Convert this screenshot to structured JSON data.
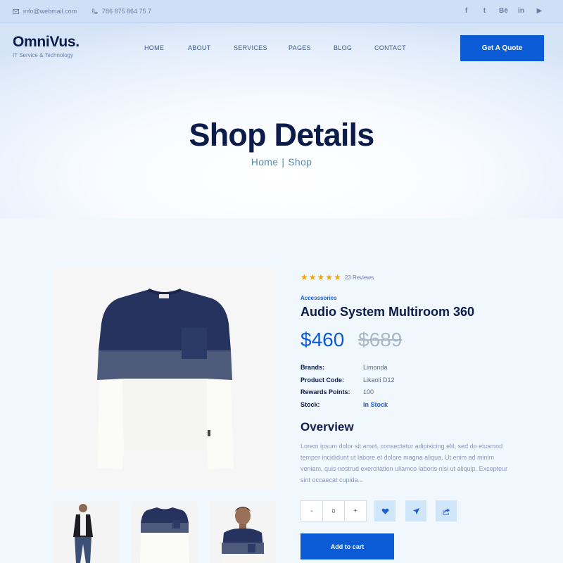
{
  "topbar": {
    "email": "info@webmail.com",
    "phone": "786 875 864 75 7",
    "social": [
      "f",
      "t",
      "Bē",
      "in",
      "▶"
    ]
  },
  "brand": {
    "name": "OmniVus.",
    "tagline": "IT Service & Technology"
  },
  "nav": [
    "HOME",
    "ABOUT",
    "SERVICES",
    "PAGES",
    "BLOG",
    "CONTACT"
  ],
  "quote_button": "Get A Quote",
  "hero": {
    "title": "Shop Details",
    "breadcrumb": [
      "Home",
      "Shop"
    ],
    "separator": "|"
  },
  "product": {
    "rating": 5,
    "reviews": "23 Reviews",
    "category": "Accesssories",
    "title": "Audio System Multiroom 360",
    "price": "$460",
    "old_price": "$689",
    "specs": [
      {
        "label": "Brands:",
        "value": "Limonda"
      },
      {
        "label": "Product Code:",
        "value": "Likaoli D12"
      },
      {
        "label": "Rewards Points:",
        "value": "100"
      },
      {
        "label": "Stock:",
        "value": "In Stock"
      }
    ],
    "overview_title": "Overview",
    "overview_text": "Lorem ipsum dolor sit amet, consectetur adipisicing elit, sed do eiusmod tempor incididunt ut labore et dolore magna aliqua. Ut enim ad minim veniam, quis nostrud exercitation ullamco laboris nisi ut aliquip. Excepteur sint occaecat cupida...",
    "quantity": "0",
    "minus": "-",
    "plus": "+",
    "add_to_cart": "Add to cart"
  },
  "colors": {
    "accent": "#0b5ad6",
    "heading": "#0b1b4a",
    "star": "#f5a300",
    "body_text": "#8a9aba"
  },
  "icons": [
    "mail-icon",
    "phone-icon",
    "facebook-icon",
    "twitter-icon",
    "behance-icon",
    "linkedin-icon",
    "youtube-icon",
    "heart-icon",
    "send-icon",
    "share-icon"
  ]
}
